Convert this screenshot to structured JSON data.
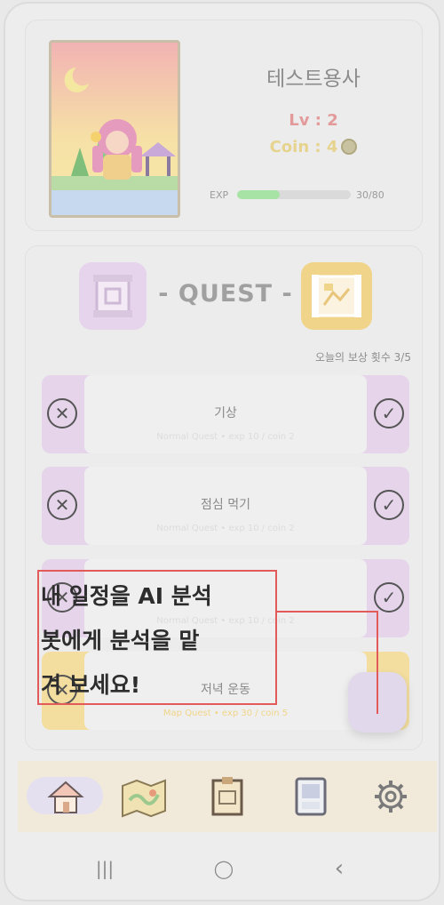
{
  "profile": {
    "name": "테스트용사",
    "level": "Lv : 2",
    "coin": "Coin : 4",
    "exp_label": "EXP",
    "exp_value": "30/80",
    "exp_progress": 0.375
  },
  "quest": {
    "title": "- QUEST -",
    "count": "오늘의 보상 횟수 3/5",
    "items": [
      {
        "name": "기상",
        "info": "Normal Quest • exp 10 / coin 2",
        "color": "purple"
      },
      {
        "name": "점심 먹기",
        "info": "Normal Quest • exp 10 / coin 2",
        "color": "purple"
      },
      {
        "name": "",
        "info": "Normal Quest • exp 10 / coin 2",
        "color": "purple"
      },
      {
        "name": "저녁 운동",
        "info": "Map Quest • exp 30 / coin 5",
        "color": "yellow"
      }
    ]
  },
  "tooltip": {
    "line1": "내 일정을 AI 분석",
    "line2": "봇에게 분석을 맡",
    "line3": "겨 보세요!"
  },
  "nav": {
    "items": [
      "home-icon",
      "map-icon",
      "quest-board-icon",
      "shop-icon",
      "gear-icon"
    ]
  },
  "system": {
    "recent": "|||",
    "home": "◯",
    "back": "‹"
  },
  "colors": {
    "accent_red": "#e35a5a",
    "purple": "#e5d4ea",
    "yellow": "#f3dea0",
    "exp_green": "#a6e3a5"
  }
}
